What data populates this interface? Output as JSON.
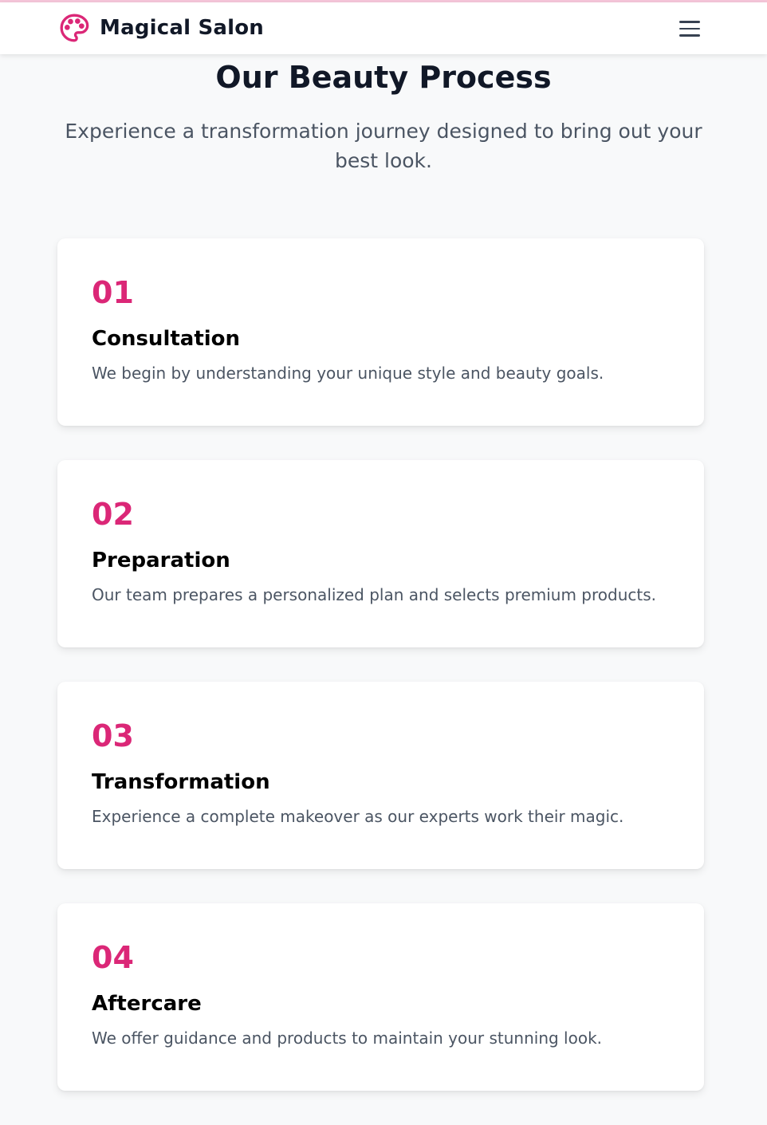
{
  "brand": {
    "name": "Magical Salon",
    "logo_icon": "palette-icon",
    "accent_color": "#db2777"
  },
  "nav": {
    "menu_icon": "hamburger-menu-icon"
  },
  "hero": {
    "title": "Our Beauty Process",
    "subtitle": "Experience a transformation journey designed to bring out your best look."
  },
  "steps": [
    {
      "number": "01",
      "title": "Consultation",
      "description": "We begin by understanding your unique style and beauty goals."
    },
    {
      "number": "02",
      "title": "Preparation",
      "description": "Our team prepares a personalized plan and selects premium products."
    },
    {
      "number": "03",
      "title": "Transformation",
      "description": "Experience a complete makeover as our experts work their magic."
    },
    {
      "number": "04",
      "title": "Aftercare",
      "description": "We offer guidance and products to maintain your stunning look."
    }
  ]
}
